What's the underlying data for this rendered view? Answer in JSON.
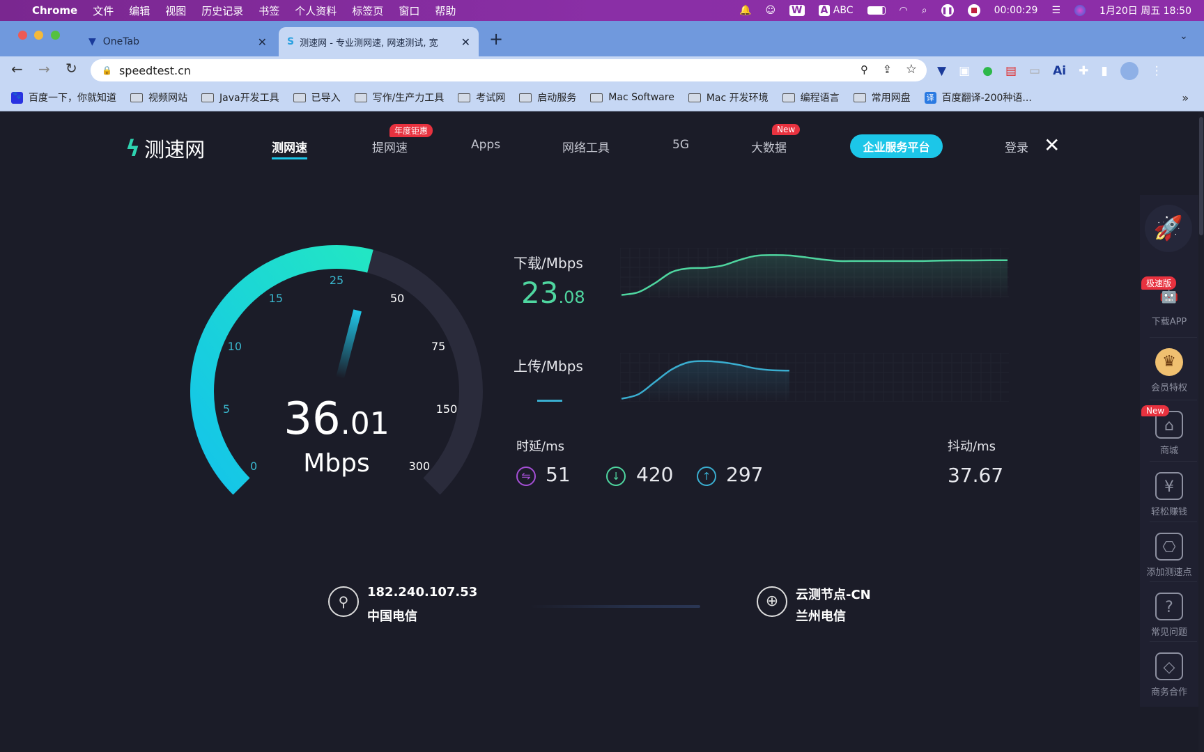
{
  "menubar": {
    "app": "Chrome",
    "items": [
      "文件",
      "编辑",
      "视图",
      "历史记录",
      "书签",
      "个人资料",
      "标签页",
      "窗口",
      "帮助"
    ],
    "input_method": "ABC",
    "timer": "00:00:29",
    "datetime": "1月20日 周五  18:50"
  },
  "tabs": [
    {
      "title": "OneTab"
    },
    {
      "title": "测速网 - 专业测网速, 网速测试, 宽"
    }
  ],
  "address": {
    "url": "speedtest.cn"
  },
  "bookmarks": [
    {
      "label": "百度一下，你就知道",
      "icon": "baidu-icon"
    },
    {
      "label": "视频网站"
    },
    {
      "label": "Java开发工具"
    },
    {
      "label": "已导入"
    },
    {
      "label": "写作/生产力工具"
    },
    {
      "label": "考试网"
    },
    {
      "label": "启动服务"
    },
    {
      "label": "Mac Software"
    },
    {
      "label": "Mac 开发环境"
    },
    {
      "label": "编程语言"
    },
    {
      "label": "常用网盘"
    },
    {
      "label": "百度翻译-200种语...",
      "icon": "translate-icon"
    }
  ],
  "site": {
    "logo": "测速网",
    "nav": [
      {
        "label": "测网速",
        "active": true
      },
      {
        "label": "提网速",
        "badge": "年度钜惠"
      },
      {
        "label": "Apps"
      },
      {
        "label": "网络工具"
      },
      {
        "label": "5G"
      },
      {
        "label": "大数据",
        "badge": "New"
      }
    ],
    "enterprise_button": "企业服务平台",
    "login": "登录"
  },
  "gauge": {
    "value_int": "36",
    "value_dec": ".01",
    "unit": "Mbps",
    "value": 36.01,
    "ticks": [
      0,
      5,
      10,
      15,
      25,
      50,
      75,
      150,
      300
    ]
  },
  "download": {
    "label": "下载/Mbps",
    "value_int": "23",
    "value_dec": ".08"
  },
  "upload": {
    "label": "上传/Mbps",
    "value": "—"
  },
  "latency": {
    "label": "时延/ms",
    "idle": "51",
    "down": "420",
    "up": "297"
  },
  "jitter": {
    "label": "抖动/ms",
    "value": "37.67"
  },
  "client": {
    "ip": "182.240.107.53",
    "isp": "中国电信"
  },
  "server": {
    "name": "云测节点-CN",
    "isp": "兰州电信"
  },
  "sidebar": [
    {
      "label": "下载APP",
      "badge": "极速版",
      "icon": "android-icon"
    },
    {
      "label": "会员特权",
      "icon": "crown-icon"
    },
    {
      "label": "商城",
      "badge": "New",
      "icon": "store-icon"
    },
    {
      "label": "轻松赚钱",
      "icon": "money-bag-icon"
    },
    {
      "label": "添加测速点",
      "icon": "network-node-icon"
    },
    {
      "label": "常见问题",
      "icon": "question-icon"
    },
    {
      "label": "商务合作",
      "icon": "handshake-icon"
    }
  ],
  "colors": {
    "accent": "#17c6e8",
    "download": "#4fd6a0",
    "upload": "#3aaed0",
    "badge": "#e8323f",
    "latency": "#a54fd6"
  },
  "chart_data": [
    {
      "type": "line",
      "series": [
        {
          "name": "下载/Mbps",
          "values": [
            0.5,
            2,
            7,
            13,
            15,
            15.3,
            16.5,
            19.5,
            21.8,
            22.2,
            22,
            21,
            19.8,
            19,
            19,
            19,
            19,
            19,
            19,
            19.2,
            19.3,
            19.3,
            19.4,
            19.4
          ]
        }
      ],
      "xlim": [
        0,
        23
      ],
      "ylim": [
        0,
        25
      ],
      "grid": true
    },
    {
      "type": "line",
      "series": [
        {
          "name": "上传/Mbps",
          "values": [
            0.5,
            3,
            10,
            17,
            21,
            21.6,
            21,
            19.5,
            17.5,
            16.5,
            16.3
          ]
        }
      ],
      "xlim": [
        0,
        23
      ],
      "ylim": [
        0,
        25
      ],
      "grid": true
    }
  ]
}
